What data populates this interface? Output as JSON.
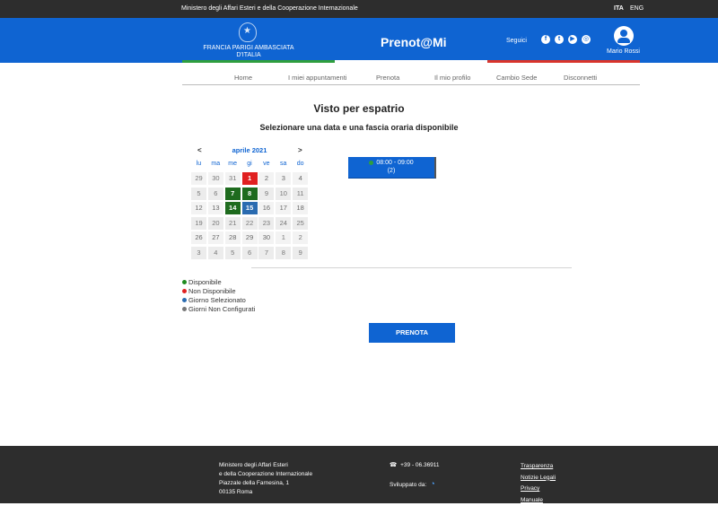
{
  "topbar": {
    "ministry": "Ministero degli Affari Esteri e della Cooperazione Internazionale",
    "lang_ita": "ITA",
    "lang_eng": "ENG"
  },
  "header": {
    "embassy_line1": "FRANCIA PARIGI AMBASCIATA",
    "embassy_line2": "D'ITALIA",
    "app_title": "Prenot@Mi",
    "follow_label": "Seguici",
    "social": [
      "f",
      "t",
      "▶",
      "◎"
    ],
    "username": "Mario Rossi"
  },
  "nav": [
    "Home",
    "I miei appuntamenti",
    "Prenota",
    "Il mio profilo",
    "Cambio Sede",
    "Disconnetti"
  ],
  "main": {
    "title": "Visto per espatrio",
    "subtitle": "Selezionare una data e una fascia oraria disponibile"
  },
  "calendar": {
    "prev": "<",
    "next": ">",
    "month": "aprile 2021",
    "dow": [
      "lu",
      "ma",
      "me",
      "gi",
      "ve",
      "sa",
      "do"
    ],
    "weeks": [
      [
        {
          "d": "29",
          "s": "other"
        },
        {
          "d": "30",
          "s": "other"
        },
        {
          "d": "31",
          "s": "other"
        },
        {
          "d": "1",
          "s": "unavail"
        },
        {
          "d": "2",
          "s": "none"
        },
        {
          "d": "3",
          "s": "none"
        },
        {
          "d": "4",
          "s": "none"
        }
      ],
      [
        {
          "d": "5",
          "s": "unconf"
        },
        {
          "d": "6",
          "s": "unconf"
        },
        {
          "d": "7",
          "s": "avail"
        },
        {
          "d": "8",
          "s": "avail"
        },
        {
          "d": "9",
          "s": "unconf"
        },
        {
          "d": "10",
          "s": "unconf"
        },
        {
          "d": "11",
          "s": "unconf"
        }
      ],
      [
        {
          "d": "12",
          "s": "none"
        },
        {
          "d": "13",
          "s": "none"
        },
        {
          "d": "14",
          "s": "avail"
        },
        {
          "d": "15",
          "s": "selected"
        },
        {
          "d": "16",
          "s": "none"
        },
        {
          "d": "17",
          "s": "none"
        },
        {
          "d": "18",
          "s": "none"
        }
      ],
      [
        {
          "d": "19",
          "s": "unconf"
        },
        {
          "d": "20",
          "s": "unconf"
        },
        {
          "d": "21",
          "s": "unconf"
        },
        {
          "d": "22",
          "s": "unconf"
        },
        {
          "d": "23",
          "s": "unconf"
        },
        {
          "d": "24",
          "s": "unconf"
        },
        {
          "d": "25",
          "s": "unconf"
        }
      ],
      [
        {
          "d": "26",
          "s": "none"
        },
        {
          "d": "27",
          "s": "none"
        },
        {
          "d": "28",
          "s": "none"
        },
        {
          "d": "29",
          "s": "none"
        },
        {
          "d": "30",
          "s": "none"
        },
        {
          "d": "1",
          "s": "other"
        },
        {
          "d": "2",
          "s": "other"
        }
      ],
      [
        {
          "d": "3",
          "s": "unconf"
        },
        {
          "d": "4",
          "s": "unconf"
        },
        {
          "d": "5",
          "s": "unconf"
        },
        {
          "d": "6",
          "s": "unconf"
        },
        {
          "d": "7",
          "s": "unconf"
        },
        {
          "d": "8",
          "s": "unconf"
        },
        {
          "d": "9",
          "s": "unconf"
        }
      ]
    ]
  },
  "slot": {
    "time": "08:00 - 09:00",
    "count": "(2)"
  },
  "legend": [
    {
      "label": "Disponibile",
      "color": "#1e8a1e"
    },
    {
      "label": "Non Disponibile",
      "color": "#e02020"
    },
    {
      "label": "Giorno Selezionato",
      "color": "#2a6bb0"
    },
    {
      "label": "Giorni Non Configurati",
      "color": "#777777"
    }
  ],
  "button": {
    "prenota": "PRENOTA"
  },
  "footer": {
    "address": [
      "Ministero degli Affari Esteri",
      "e della Cooperazione Internazionale",
      "Piazzale della Farnesina, 1",
      "00135 Roma"
    ],
    "phone": "+39 - 06.36911",
    "developed_by": "Sviluppato da:",
    "links": [
      "Trasparenza",
      "Notizie Legali",
      "Privacy",
      "Manuale"
    ]
  }
}
